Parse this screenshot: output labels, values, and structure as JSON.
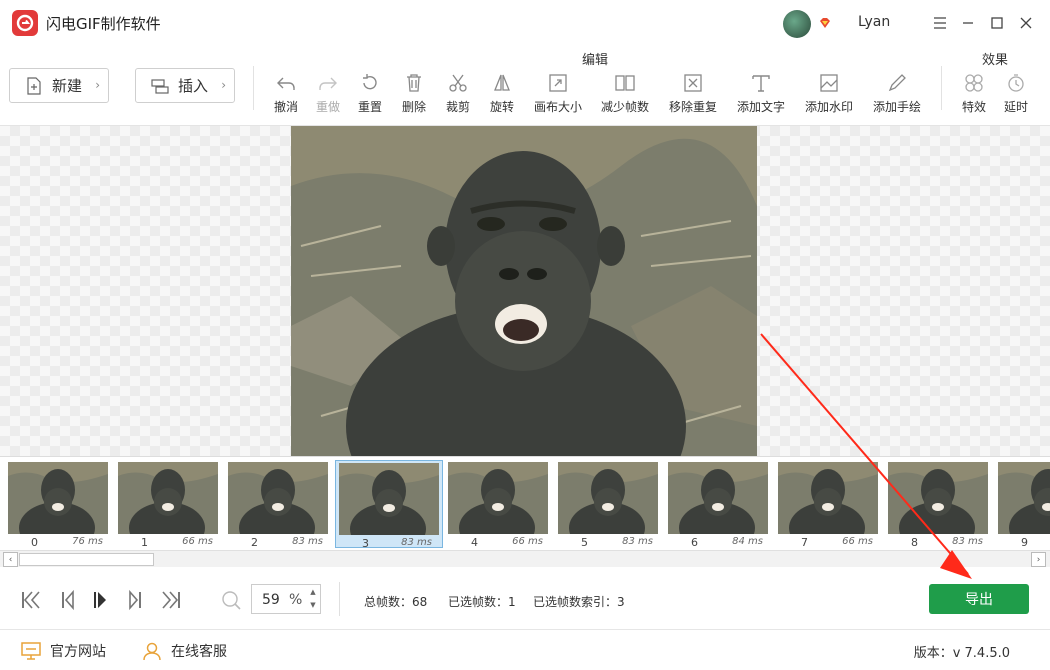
{
  "app": {
    "title": "闪电GIF制作软件",
    "user_name": "Lyan"
  },
  "toolbar": {
    "new_label": "新建",
    "insert_label": "插入",
    "edit_group_label": "编辑",
    "effects_group_label": "效果",
    "tools": [
      {
        "label": "撤消",
        "icon": "undo-icon",
        "enabled": true
      },
      {
        "label": "重做",
        "icon": "redo-icon",
        "enabled": false
      },
      {
        "label": "重置",
        "icon": "reset-icon",
        "enabled": true
      },
      {
        "label": "删除",
        "icon": "delete-icon",
        "enabled": true
      },
      {
        "label": "裁剪",
        "icon": "crop-icon",
        "enabled": true
      },
      {
        "label": "旋转",
        "icon": "rotate-icon",
        "enabled": true
      },
      {
        "label": "画布大小",
        "icon": "canvas-size-icon",
        "enabled": true
      },
      {
        "label": "减少帧数",
        "icon": "reduce-frames-icon",
        "enabled": true
      },
      {
        "label": "移除重复",
        "icon": "remove-duplicates-icon",
        "enabled": true
      },
      {
        "label": "添加文字",
        "icon": "add-text-icon",
        "enabled": true
      },
      {
        "label": "添加水印",
        "icon": "add-watermark-icon",
        "enabled": true
      },
      {
        "label": "添加手绘",
        "icon": "add-drawing-icon",
        "enabled": true
      }
    ],
    "effects": [
      {
        "label": "特效",
        "icon": "effects-icon"
      },
      {
        "label": "延时",
        "icon": "delay-icon"
      }
    ]
  },
  "frames": [
    {
      "index": "0",
      "duration": "76 ms"
    },
    {
      "index": "1",
      "duration": "66 ms"
    },
    {
      "index": "2",
      "duration": "83 ms"
    },
    {
      "index": "3",
      "duration": "83 ms",
      "selected": true
    },
    {
      "index": "4",
      "duration": "66 ms"
    },
    {
      "index": "5",
      "duration": "83 ms"
    },
    {
      "index": "6",
      "duration": "84 ms"
    },
    {
      "index": "7",
      "duration": "66 ms"
    },
    {
      "index": "8",
      "duration": "83 ms"
    },
    {
      "index": "9",
      "duration": ""
    }
  ],
  "playback": {
    "zoom_value": "59",
    "zoom_unit": "%",
    "total_frames": "总帧数：68",
    "selected_frames": "已选帧数：1",
    "selected_index": "已选帧数索引：3",
    "export_label": "导出"
  },
  "footer": {
    "website_label": "官方网站",
    "support_label": "在线客服",
    "version": "版本：v 7.4.5.0"
  },
  "colors": {
    "accent_green": "#1f9d4a",
    "logo_red": "#e23a3a",
    "selection_blue": "#cfe6f7",
    "annotation_red": "#ff2a1a"
  }
}
